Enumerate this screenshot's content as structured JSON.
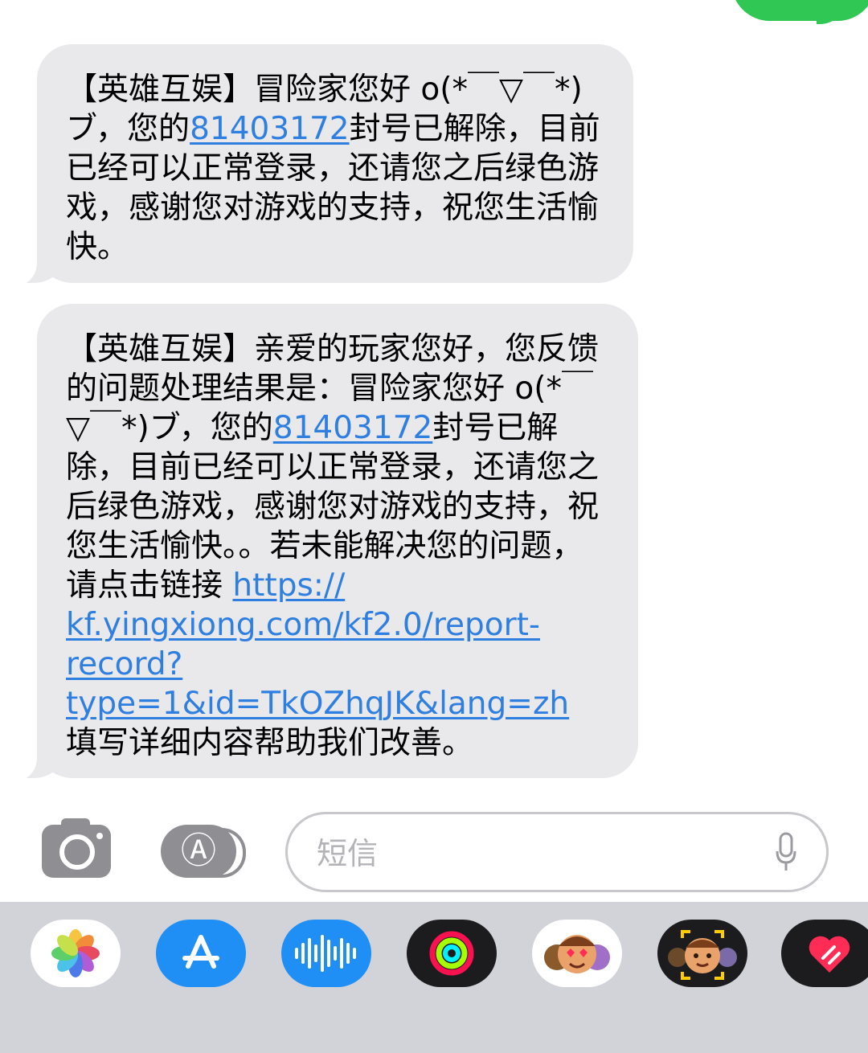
{
  "messages": [
    {
      "before_link": "【英雄互娱】冒险家您好 o(*￣▽￣*)ブ，您的",
      "link": "81403172",
      "after_link": "封号已解除，目前已经可以正常登录，还请您之后绿色游戏，感谢您对游戏的支持，祝您生活愉快。"
    },
    {
      "line_a": "【英雄互娱】亲爱的玩家您好，您反馈的问题处理结果是：冒险家您好 o(*￣▽￣*)ブ，您的",
      "link_number": "81403172",
      "line_b": "封号已解除，目前已经可以正常登录，还请您之后绿色游戏，感谢您对游戏的支持，祝您生活愉快。。若未能解决您的问题，请点击链接",
      "url_1": "https://",
      "url_2": "kf.yingxiong.com/kf2.0/report-",
      "url_3": "record?",
      "url_4": "type=1&id=TkOZhqJK&lang=zh",
      "line_c": "填写详细内容帮助我们改善。"
    }
  ],
  "composer": {
    "placeholder": "短信",
    "camera_icon": "camera-icon",
    "apps_icon": "app-store-icon",
    "mic_icon": "microphone-icon"
  },
  "app_drawer": [
    "photos-icon",
    "app-store-icon",
    "audio-message-icon",
    "fitness-icon",
    "memoji-stickers-icon",
    "memoji-camera-icon",
    "digital-touch-icon"
  ],
  "colors": {
    "received_bubble": "#e9e9eb",
    "sent_bubble": "#30c755",
    "link": "#2f7fe1",
    "drawer": "#d1d3d9"
  }
}
